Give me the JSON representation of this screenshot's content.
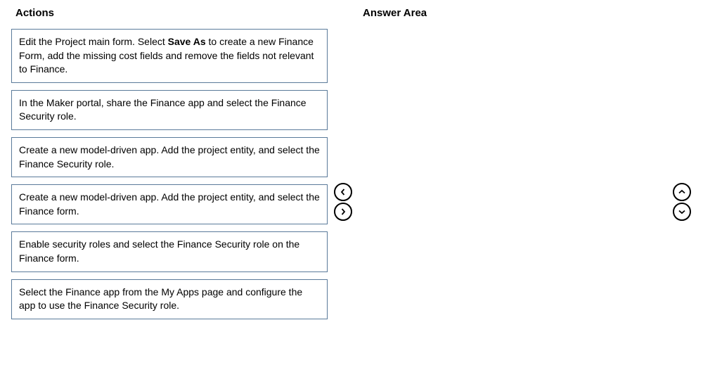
{
  "headings": {
    "actions": "Actions",
    "answer": "Answer Area"
  },
  "actions": [
    {
      "prefix": "Edit the Project main form. Select ",
      "bold": "Save As",
      "suffix": " to create a new Finance Form, add the missing cost fields and remove the fields not relevant to Finance."
    },
    {
      "prefix": "In the Maker portal, share the Finance app and select the Finance Security role.",
      "bold": "",
      "suffix": ""
    },
    {
      "prefix": "Create a new model-driven app. Add the project entity, and select the Finance Security role.",
      "bold": "",
      "suffix": ""
    },
    {
      "prefix": "Create a new model-driven app. Add the project entity, and select the Finance form.",
      "bold": "",
      "suffix": ""
    },
    {
      "prefix": "Enable security roles and select the Finance Security role on the Finance form.",
      "bold": "",
      "suffix": ""
    },
    {
      "prefix": "Select the Finance app from the My Apps page and configure the app to use the Finance Security role.",
      "bold": "",
      "suffix": ""
    }
  ]
}
